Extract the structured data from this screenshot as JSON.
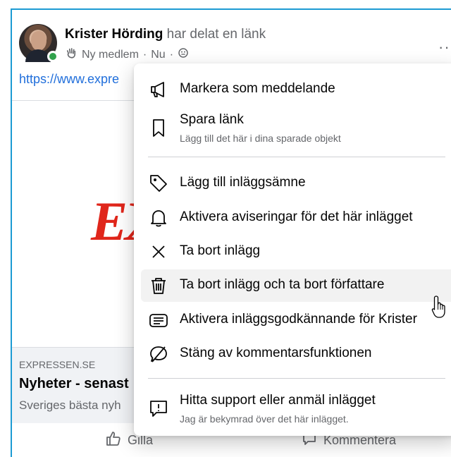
{
  "post": {
    "author_name": "Krister Hörding",
    "author_action": "har delat en länk",
    "badge_label": "Ny medlem",
    "separator": "·",
    "time": "Nu",
    "more_label": "···",
    "link_text": "https://www.expre",
    "preview": {
      "logo_text": "EX",
      "domain": "EXPRESSEN.SE",
      "title": "Nyheter - senast",
      "description": "Sveriges bästa nyh"
    },
    "actions": {
      "like_label": "Gilla",
      "comment_label": "Kommentera"
    }
  },
  "menu": {
    "items": [
      {
        "label": "Markera som meddelande",
        "icon": "megaphone-icon"
      },
      {
        "label": "Spara länk",
        "sublabel": "Lägg till det här i dina sparade objekt",
        "icon": "bookmark-icon"
      },
      {
        "label": "Lägg till inläggsämne",
        "icon": "tag-icon"
      },
      {
        "label": "Aktivera aviseringar för det här inlägget",
        "icon": "bell-icon"
      },
      {
        "label": "Ta bort inlägg",
        "icon": "close-icon"
      },
      {
        "label": "Ta bort inlägg och ta bort författare",
        "icon": "trash-icon"
      },
      {
        "label": "Aktivera inläggsgodkännande för Krister",
        "icon": "approval-icon"
      },
      {
        "label": "Stäng av kommentarsfunktionen",
        "icon": "comment-off-icon"
      },
      {
        "label": "Hitta support eller anmäl inlägget",
        "sublabel": "Jag är bekymrad över det här inlägget.",
        "icon": "report-icon"
      }
    ]
  },
  "colors": {
    "link": "#216fdb",
    "logo_red": "#e0261b",
    "online": "#31a24c",
    "hover": "#f2f2f2"
  }
}
